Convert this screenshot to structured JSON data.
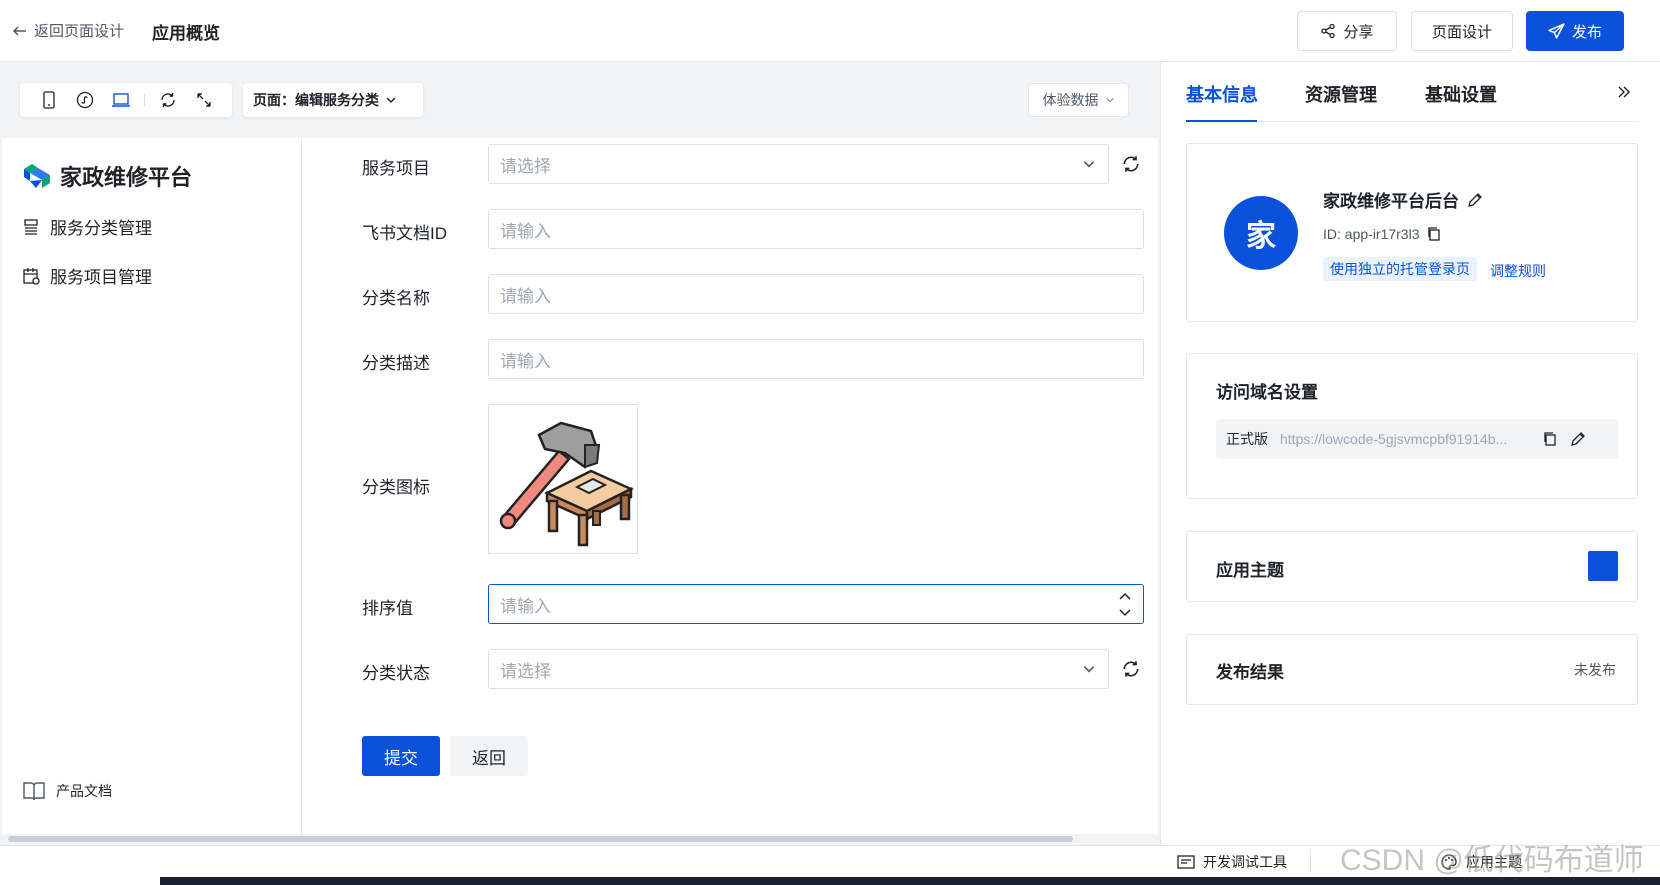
{
  "header": {
    "back_label": "返回页面设计",
    "title": "应用概览",
    "share_label": "分享",
    "page_design_label": "页面设计",
    "publish_label": "发布"
  },
  "toolbar": {
    "icons": [
      "mobile-icon",
      "mini-program-icon",
      "desktop-icon",
      "refresh-icon",
      "fullscreen-icon"
    ],
    "page_select": "页面：编辑服务分类",
    "experience_data": "体验数据"
  },
  "sidebar": {
    "brand": "家政维修平台",
    "items": [
      {
        "label": "服务分类管理",
        "icon": "category-icon"
      },
      {
        "label": "服务项目管理",
        "icon": "calendar-icon"
      }
    ],
    "doc_label": "产品文档"
  },
  "form": {
    "fields": [
      {
        "label": "服务项目",
        "placeholder": "请选择"
      },
      {
        "label": "飞书文档ID",
        "placeholder": "请输入"
      },
      {
        "label": "分类名称",
        "placeholder": "请输入"
      },
      {
        "label": "分类描述",
        "placeholder": "请输入"
      },
      {
        "label": "分类图标"
      },
      {
        "label": "排序值",
        "placeholder": "请输入"
      },
      {
        "label": "分类状态",
        "placeholder": "请选择"
      }
    ],
    "submit_label": "提交",
    "back_label": "返回"
  },
  "right_panel": {
    "tabs": [
      "基本信息",
      "资源管理",
      "基础设置"
    ],
    "active_tab": "基本信息",
    "app": {
      "avatar_char": "家",
      "name": "家政维修平台后台",
      "id": "ID: app-ir17r3l3",
      "login_tag": "使用独立的托管登录页",
      "rule_link": "调整规则"
    },
    "domain": {
      "title": "访问域名设置",
      "env": "正式版",
      "url": "https://lowcode-5gjsvmcpbf91914b..."
    },
    "theme": {
      "title": "应用主题",
      "color": "#0a52dc"
    },
    "publish": {
      "title": "发布结果",
      "status": "未发布"
    }
  },
  "bottombar": {
    "devtools_label": "开发调试工具",
    "theme_label": "应用主题"
  },
  "watermark": "CSDN @低代码布道师"
}
